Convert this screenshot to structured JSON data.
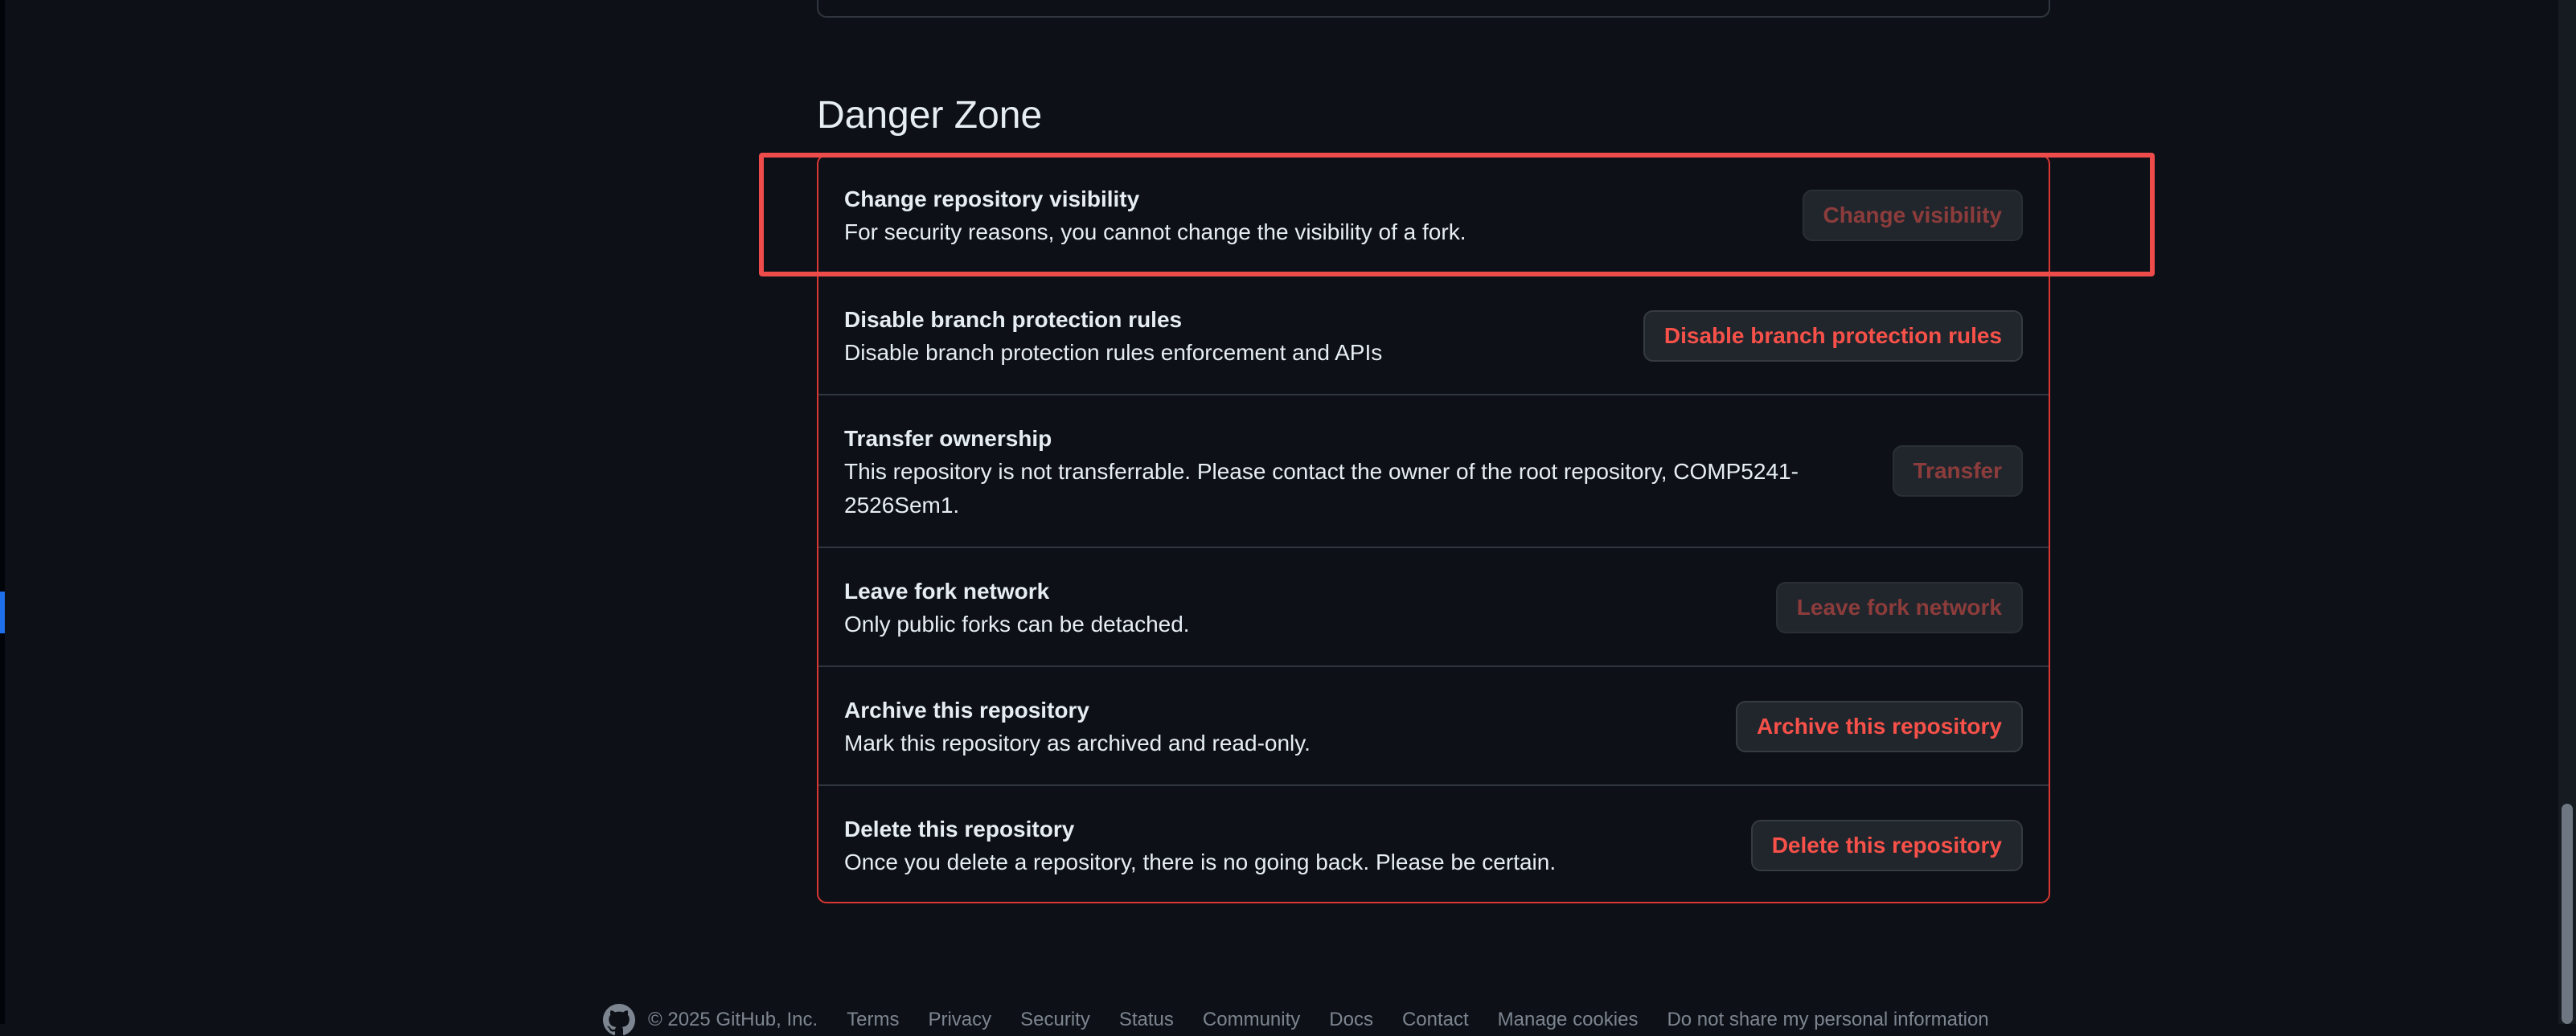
{
  "danger_zone": {
    "title": "Danger Zone",
    "rows": [
      {
        "title": "Change repository visibility",
        "description": "For security reasons, you cannot change the visibility of a fork.",
        "button": "Change visibility"
      },
      {
        "title": "Disable branch protection rules",
        "description": "Disable branch protection rules enforcement and APIs",
        "button": "Disable branch protection rules"
      },
      {
        "title": "Transfer ownership",
        "description_line1": "This repository is not transferrable. Please contact the owner of the root repository, COMP5241-",
        "description_line2": "2526Sem1.",
        "button": "Transfer"
      },
      {
        "title": "Leave fork network",
        "description": "Only public forks can be detached.",
        "button": "Leave fork network"
      },
      {
        "title": "Archive this repository",
        "description": "Mark this repository as archived and read-only.",
        "button": "Archive this repository"
      },
      {
        "title": "Delete this repository",
        "description": "Once you delete a repository, there is no going back. Please be certain.",
        "button": "Delete this repository"
      }
    ]
  },
  "footer": {
    "copyright": "© 2025 GitHub, Inc.",
    "links": [
      "Terms",
      "Privacy",
      "Security",
      "Status",
      "Community",
      "Docs",
      "Contact",
      "Manage cookies",
      "Do not share my personal information"
    ]
  },
  "colors": {
    "background": "#0d1117",
    "danger": "#f85149",
    "danger_border": "#da3633",
    "highlight": "#ee4b4b"
  },
  "icons": {
    "footer_logo": "github-logo-icon"
  }
}
